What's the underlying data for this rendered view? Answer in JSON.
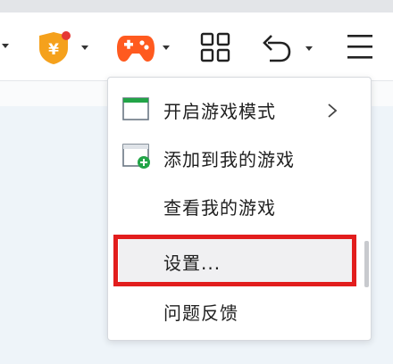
{
  "toolbar": {
    "buttons": [
      {
        "name": "wallet-button",
        "icon": "yuan-shield-icon",
        "has_dropdown": true
      },
      {
        "name": "game-button",
        "icon": "gamepad-icon",
        "has_dropdown": true
      },
      {
        "name": "apps-button",
        "icon": "grid-icon",
        "has_dropdown": false
      },
      {
        "name": "undo-button",
        "icon": "undo-arrow-icon",
        "has_dropdown": true
      },
      {
        "name": "menu-button",
        "icon": "hamburger-icon",
        "has_dropdown": false
      }
    ],
    "colors": {
      "shield": "#f5a11c",
      "gamepad": "#ff5a1f",
      "badge": "#e53935"
    }
  },
  "menu": {
    "items": [
      {
        "label": "开启游戏模式",
        "icon": "window-icon",
        "has_submenu": true
      },
      {
        "label": "添加到我的游戏",
        "icon": "window-add-icon",
        "has_submenu": false
      },
      {
        "label": "查看我的游戏",
        "icon": "",
        "has_submenu": false
      },
      {
        "label": "设置...",
        "icon": "",
        "has_submenu": false,
        "highlighted": true
      },
      {
        "label": "问题反馈",
        "icon": "",
        "has_submenu": false
      }
    ],
    "highlight_color": "#e21d1d",
    "accent_green": "#22a447"
  }
}
